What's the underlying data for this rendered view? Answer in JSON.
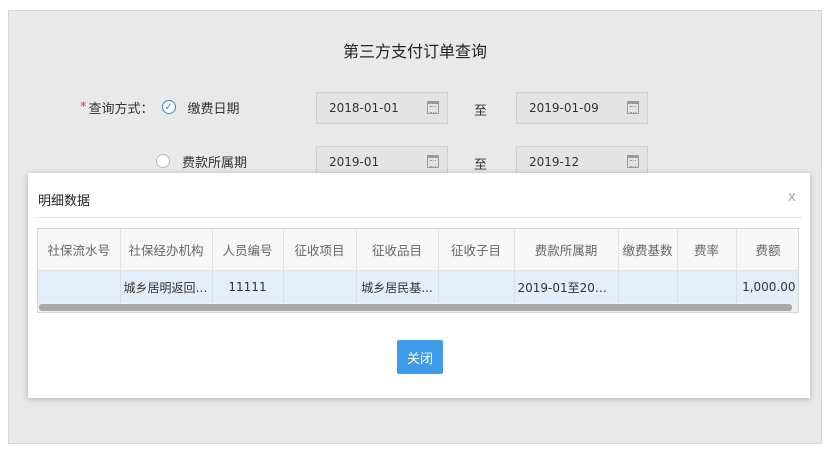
{
  "form": {
    "title": "第三方支付订单查询",
    "query_label": "查询方式：",
    "required_mark": "*",
    "option1_label": "缴费日期",
    "option2_label": "费款所属期",
    "date_start": "2018-01-01",
    "date_end": "2019-01-09",
    "period_start": "2019-01",
    "period_end": "2019-12",
    "to_label": "至"
  },
  "modal": {
    "title": "明细数据",
    "close_icon": "x",
    "close_button": "关闭",
    "columns": [
      "社保流水号",
      "社保经办机构",
      "人员编号",
      "征收项目",
      "征收品目",
      "征收子目",
      "费款所属期",
      "缴费基数",
      "费率",
      "费额"
    ],
    "rows": [
      [
        "",
        "城乡居明返回信...",
        "11111",
        "",
        "城乡居民基...",
        "",
        "2019-01至2019-...",
        "",
        "",
        "1,000.00"
      ]
    ]
  },
  "colors": {
    "accent": "#3d9be9",
    "row_highlight": "#e3eefb",
    "required": "#e03b3b"
  }
}
